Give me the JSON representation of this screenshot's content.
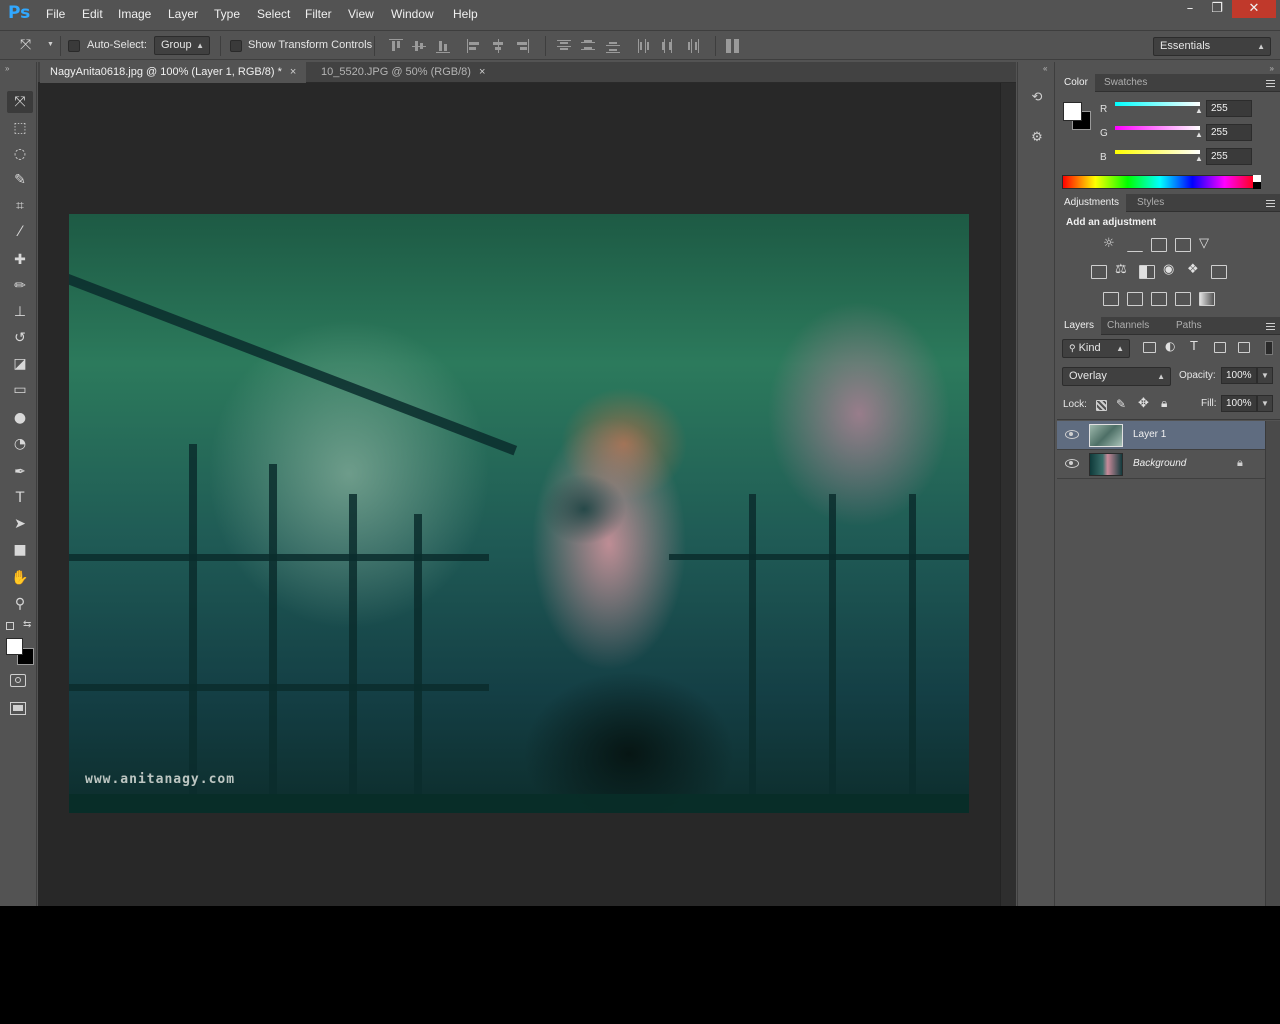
{
  "app": {
    "logo": "Ps"
  },
  "menu": [
    "File",
    "Edit",
    "Image",
    "Layer",
    "Type",
    "Select",
    "Filter",
    "View",
    "Window",
    "Help"
  ],
  "window_controls": {
    "minimize": "–",
    "restore": "❐",
    "close": "✕"
  },
  "options_bar": {
    "auto_select_label": "Auto-Select:",
    "auto_select_value": "Group",
    "transform_label": "Show Transform Controls",
    "workspace": "Essentials"
  },
  "tabs": [
    {
      "title": "NagyAnita0618.jpg @ 100% (Layer 1, RGB/8) *",
      "close": "×"
    },
    {
      "title": "10_5520.JPG @ 50% (RGB/8)",
      "close": "×"
    }
  ],
  "canvas": {
    "watermark": "www.anitanagy.com"
  },
  "tools": [
    {
      "name": "move-tool",
      "glyph": "⤧"
    },
    {
      "name": "marquee-tool",
      "glyph": "⬚"
    },
    {
      "name": "lasso-tool",
      "glyph": "◌"
    },
    {
      "name": "quick-select-tool",
      "glyph": "✎"
    },
    {
      "name": "crop-tool",
      "glyph": "⌗"
    },
    {
      "name": "eyedropper-tool",
      "glyph": "⁄"
    },
    {
      "name": "healing-brush-tool",
      "glyph": "✚"
    },
    {
      "name": "brush-tool",
      "glyph": "✏"
    },
    {
      "name": "clone-stamp-tool",
      "glyph": "⊥"
    },
    {
      "name": "history-brush-tool",
      "glyph": "↺"
    },
    {
      "name": "eraser-tool",
      "glyph": "◪"
    },
    {
      "name": "gradient-tool",
      "glyph": "▭"
    },
    {
      "name": "blur-tool",
      "glyph": "●"
    },
    {
      "name": "dodge-tool",
      "glyph": "◔"
    },
    {
      "name": "pen-tool",
      "glyph": "✒"
    },
    {
      "name": "type-tool",
      "glyph": "T"
    },
    {
      "name": "path-select-tool",
      "glyph": "➤"
    },
    {
      "name": "shape-tool",
      "glyph": "■"
    },
    {
      "name": "hand-tool",
      "glyph": "✋"
    },
    {
      "name": "zoom-tool",
      "glyph": "⚲"
    }
  ],
  "colors": {
    "foreground": "#ffffff",
    "background": "#000000",
    "accent": "#31a8ff",
    "selected_layer": "#5f6c80"
  },
  "color_panel": {
    "tabs": [
      "Color",
      "Swatches"
    ],
    "r_label": "R",
    "r_value": "255",
    "g_label": "G",
    "g_value": "255",
    "b_label": "B",
    "b_value": "255"
  },
  "adjustments_panel": {
    "tabs": [
      "Adjustments",
      "Styles"
    ],
    "heading": "Add an adjustment"
  },
  "layers_panel": {
    "tabs": [
      "Layers",
      "Channels",
      "Paths"
    ],
    "filter_kind": "Kind",
    "blend_mode": "Overlay",
    "opacity_label": "Opacity:",
    "opacity_value": "100%",
    "lock_label": "Lock:",
    "fill_label": "Fill:",
    "fill_value": "100%",
    "layers": [
      {
        "name": "Layer 1",
        "selected": true
      },
      {
        "name": "Background",
        "locked": true
      }
    ]
  }
}
